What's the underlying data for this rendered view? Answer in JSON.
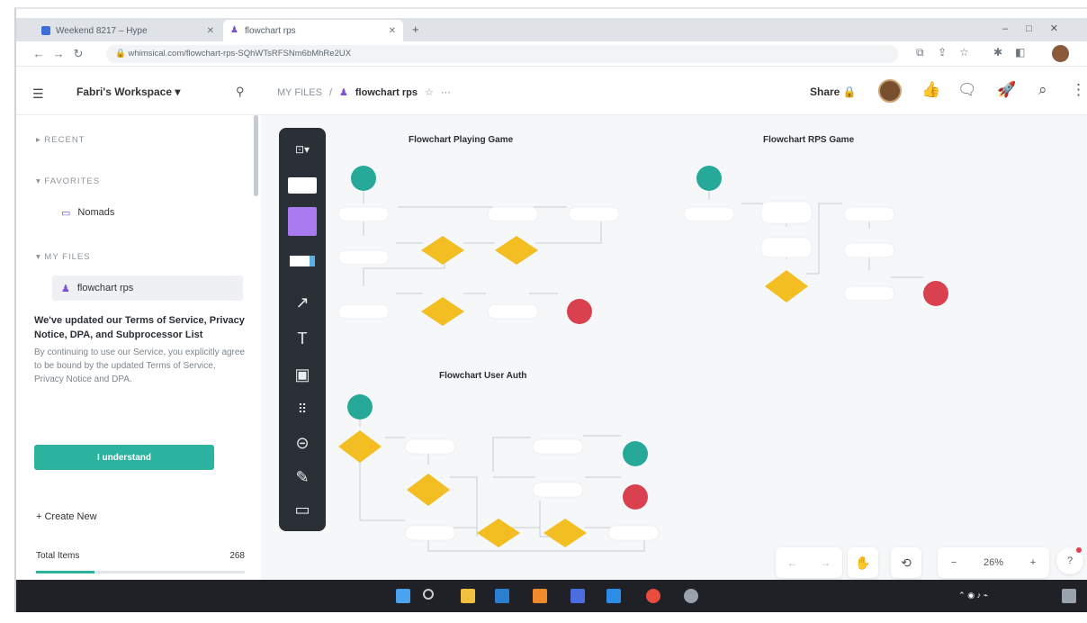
{
  "browser": {
    "tabs": [
      {
        "label": "Weekend 8217 – Hype",
        "active": false
      },
      {
        "label": "flowchart rps",
        "active": true
      }
    ],
    "url": "whimsical.com/flowchart-rps-SQhWTsRFSNm6bMhRe2UX"
  },
  "header": {
    "workspace": "Fabri's Workspace",
    "breadcrumb_root": "MY FILES",
    "breadcrumb_separator": "/",
    "file_name": "flowchart rps",
    "share_label": "Share"
  },
  "sidebar": {
    "recent_label": "RECENT",
    "favorites_label": "FAVORITES",
    "favorites": [
      {
        "label": "Nomads"
      }
    ],
    "myfiles_label": "MY FILES",
    "files": [
      {
        "label": "flowchart rps",
        "selected": true
      }
    ],
    "notice_title": "We've updated our Terms of Service, Privacy Notice, DPA, and Subprocessor List",
    "notice_body": "By continuing to use our Service, you explicitly agree to be bound by the updated Terms of Service, Privacy Notice and DPA.",
    "understand_label": "I understand",
    "create_new_label": "Create New",
    "total_items_label": "Total Items",
    "total_items_value": "268",
    "total_items_fraction": 0.28
  },
  "canvas": {
    "titles": {
      "playing": "Flowchart Playing Game",
      "rps": "Flowchart RPS Game",
      "auth": "Flowchart User Auth"
    },
    "zoom_level": "26%",
    "zoom_minus": "−",
    "zoom_plus": "+",
    "help": "?"
  },
  "colors": {
    "accent": "#2bb3a0",
    "start": "#27a99a",
    "end": "#d9414f",
    "decision": "#f2be22",
    "toolbar": "#2b3036"
  },
  "icons": [
    "menu-icon",
    "pin-icon",
    "lock-icon",
    "like-icon",
    "comment-icon",
    "rocket-icon",
    "search-icon",
    "more-icon",
    "arrow-tool-icon",
    "text-tool-icon",
    "image-tool-icon",
    "grid-tool-icon",
    "link-tool-icon",
    "pen-tool-icon",
    "frame-tool-icon",
    "hand-icon",
    "history-icon"
  ]
}
